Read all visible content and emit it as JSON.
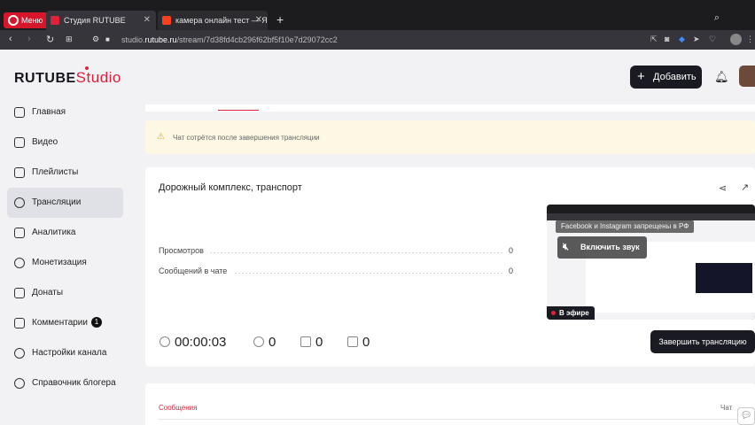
{
  "browser": {
    "menu_label": "Меню",
    "tabs": [
      {
        "title": "Студия RUTUBE",
        "favicon_color": "#e0213a"
      },
      {
        "title": "камера онлайн тест — Ян",
        "favicon_color": "#fc3f1d"
      }
    ],
    "url_prefix": "studio.",
    "url_domain": "rutube.ru",
    "url_path": "/stream/7d38fd4cb296f62bf5f10e7d29072cc2"
  },
  "header": {
    "logo_main": "RUTUBE",
    "logo_studio": "Studio",
    "add_button_label": "Добавить"
  },
  "sidebar": {
    "items": [
      {
        "label": "Главная",
        "icon": "home-icon"
      },
      {
        "label": "Видео",
        "icon": "video-icon"
      },
      {
        "label": "Плейлисты",
        "icon": "playlist-icon"
      },
      {
        "label": "Трансляции",
        "icon": "broadcast-icon",
        "active": true
      },
      {
        "label": "Аналитика",
        "icon": "analytics-icon"
      },
      {
        "label": "Монетизация",
        "icon": "ruble-icon"
      },
      {
        "label": "Донаты",
        "icon": "gift-icon"
      },
      {
        "label": "Комментарии",
        "icon": "comment-icon",
        "badge": "1"
      },
      {
        "label": "Настройки канала",
        "icon": "gear-icon"
      },
      {
        "label": "Справочник блогера",
        "icon": "info-icon"
      }
    ]
  },
  "warning": {
    "text": "Чат сотрётся после завершения трансляции"
  },
  "stream": {
    "title": "Дорожный комплекс, транспорт",
    "views_label": "Просмотров",
    "views_value": "0",
    "chat_messages_label": "Сообщений в чате",
    "chat_messages_value": "0",
    "duration": "00:00:03",
    "viewers": "0",
    "likes": "0",
    "dislikes": "0",
    "end_button_label": "Завершить трансляцию",
    "preview": {
      "overlay_text": "Facebook и Instagram запрещены в РФ",
      "sound_button_label": "Включить звук",
      "live_label": "В эфире"
    }
  },
  "messages": {
    "tab_label": "Сообщения",
    "chat_label": "Чат"
  }
}
